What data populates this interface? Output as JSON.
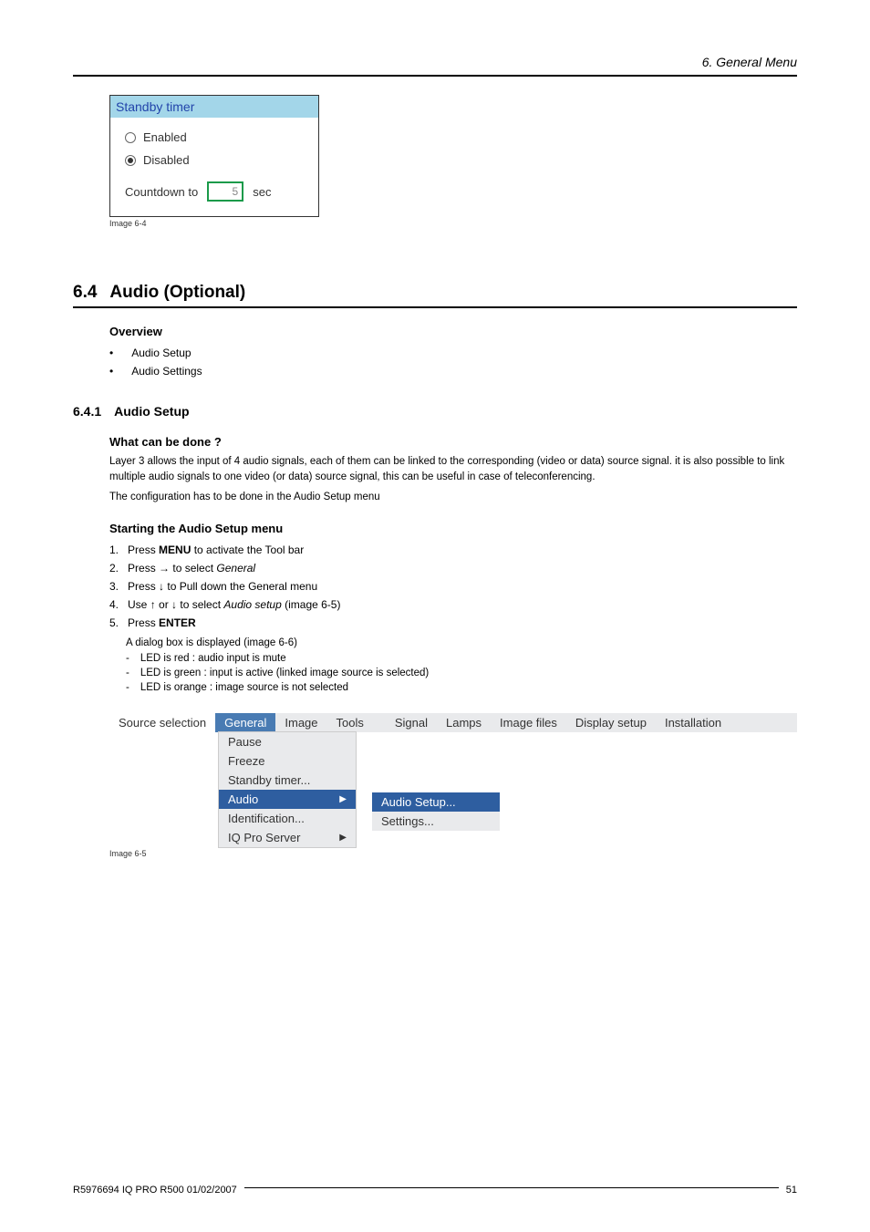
{
  "header": {
    "breadcrumb": "6.  General Menu"
  },
  "dialog_standby": {
    "title": "Standby timer",
    "enabled_label": "Enabled",
    "disabled_label": "Disabled",
    "countdown_label": "Countdown to",
    "countdown_value": "5",
    "countdown_unit": "sec"
  },
  "caption_64": "Image 6-4",
  "section": {
    "number": "6.4",
    "title": "Audio (Optional)"
  },
  "overview": {
    "heading": "Overview",
    "items": [
      "Audio Setup",
      "Audio Settings"
    ]
  },
  "subsection": {
    "number": "6.4.1",
    "title": "Audio Setup"
  },
  "what_heading": "What can be done ?",
  "what_p1": "Layer 3 allows the input of 4 audio signals, each of them can be linked to the corresponding (video or data) source signal. it is also possible to link multiple audio signals to one video (or data) source signal, this can be useful in case of teleconferencing.",
  "what_p2": "The configuration has to be done in the Audio Setup menu",
  "start_heading": "Starting the Audio Setup menu",
  "steps": {
    "s1a": "Press ",
    "s1b": "MENU",
    "s1c": " to activate the Tool bar",
    "s2a": "Press → to select ",
    "s2b": "General",
    "s3": "Press ↓ to Pull down the General menu",
    "s4a": "Use ↑ or ↓ to select ",
    "s4b": "Audio setup",
    "s4c": " (image 6-5)",
    "s5a": "Press ",
    "s5b": "ENTER",
    "after": "A dialog box is displayed (image 6-6)",
    "dash1": "LED is red : audio input is mute",
    "dash2": "LED is green : input is active (linked image source is selected)",
    "dash3": "LED is orange : image source is not selected"
  },
  "menu": {
    "source": "Source selection",
    "tabs": [
      "General",
      "Image",
      "Tools",
      "Signal",
      "Lamps",
      "Image files",
      "Display setup",
      "Installation"
    ],
    "dropdown": [
      "Pause",
      "Freeze",
      "Standby timer...",
      "Audio",
      "Identification...",
      "IQ Pro Server"
    ],
    "submenu": [
      "Audio Setup...",
      "Settings..."
    ]
  },
  "caption_65": "Image 6-5",
  "footer": {
    "left": "R5976694  IQ PRO R500  01/02/2007",
    "right": "51"
  }
}
